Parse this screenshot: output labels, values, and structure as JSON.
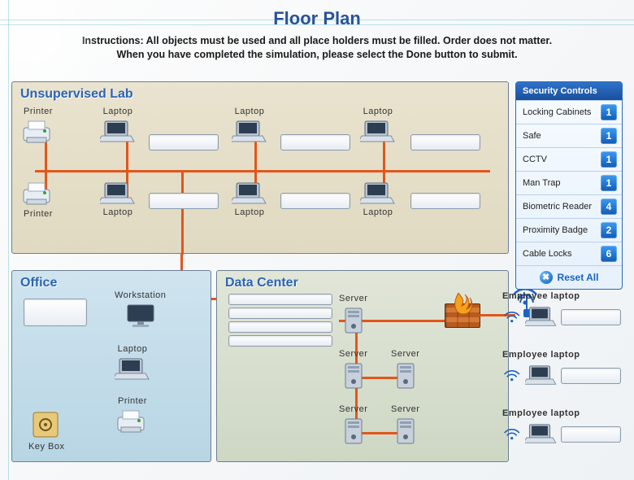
{
  "title": "Floor Plan",
  "instructions_l1": "Instructions: All objects must be used and all place holders must be filled. Order does not matter.",
  "instructions_l2": "When you have completed the simulation, please select the Done button to submit.",
  "zones": {
    "lab": "Unsupervised Lab",
    "office": "Office",
    "dc": "Data Center"
  },
  "labels": {
    "printer": "Printer",
    "laptop": "Laptop",
    "workstation": "Workstation",
    "server": "Server",
    "keybox": "Key Box",
    "employee_laptop": "Employee laptop"
  },
  "security": {
    "header": "Security Controls",
    "items": [
      {
        "name": "Locking Cabinets",
        "count": 1
      },
      {
        "name": "Safe",
        "count": 1
      },
      {
        "name": "CCTV",
        "count": 1
      },
      {
        "name": "Man Trap",
        "count": 1
      },
      {
        "name": "Biometric Reader",
        "count": 4
      },
      {
        "name": "Proximity Badge",
        "count": 2
      },
      {
        "name": "Cable Locks",
        "count": 6
      }
    ],
    "reset": "Reset  All"
  }
}
